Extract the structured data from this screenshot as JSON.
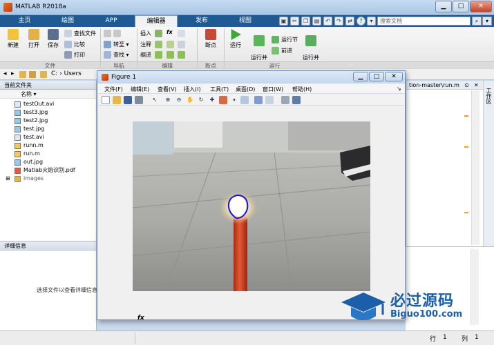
{
  "window": {
    "title": "MATLAB R2018a"
  },
  "tabs": [
    {
      "label": "主页"
    },
    {
      "label": "绘图"
    },
    {
      "label": "APP"
    },
    {
      "label": "编辑器"
    },
    {
      "label": "发布"
    },
    {
      "label": "视图"
    }
  ],
  "search": {
    "placeholder": "搜索文档"
  },
  "ribbon": {
    "file_group": {
      "label": "文件",
      "new": "新建",
      "open": "打开",
      "save": "保存",
      "find_files": "查找文件",
      "compare": "比较",
      "print": "打印"
    },
    "nav_group": {
      "label": "导航",
      "goto": "转至",
      "find": "查找"
    },
    "edit_group": {
      "label": "编辑",
      "insert": "插入",
      "comment": "注释",
      "indent": "缩进",
      "fx": "fx"
    },
    "breakpoint_group": {
      "label": "断点",
      "breakpoints": "断点"
    },
    "run_group": {
      "label": "运行",
      "run": "运行",
      "run_advance": "运行并\n前进",
      "run_section": "运行节",
      "advance": "前进",
      "run_time": "运行并\n计时"
    }
  },
  "address": {
    "path": "C: › Users"
  },
  "folder_panel": {
    "header": "当前文件夹",
    "col_name": "名称",
    "files": [
      {
        "name": "testOut.avi"
      },
      {
        "name": "test3.jpg"
      },
      {
        "name": "test2.jpg"
      },
      {
        "name": "test.jpg"
      },
      {
        "name": "test.avi"
      },
      {
        "name": "runn.m"
      },
      {
        "name": "run.m"
      },
      {
        "name": "out.jpg"
      },
      {
        "name": "Matlab火焰识别.pdf"
      },
      {
        "name": "images"
      }
    ]
  },
  "details_panel": {
    "header": "详细信息",
    "hint": "选择文件以查看详细信息"
  },
  "editor": {
    "tab_label": "tion-master\\run.m",
    "side_label": "工作区"
  },
  "cmd": {
    "prompt": "fx"
  },
  "statusbar": {
    "row_label": "行",
    "row": "1",
    "col_label": "列",
    "col": "1"
  },
  "figure": {
    "title": "Figure 1",
    "menu": [
      {
        "label": "文件(F)"
      },
      {
        "label": "编辑(E)"
      },
      {
        "label": "查看(V)"
      },
      {
        "label": "插入(I)"
      },
      {
        "label": "工具(T)"
      },
      {
        "label": "桌面(D)"
      },
      {
        "label": "窗口(W)"
      },
      {
        "label": "帮助(H)"
      }
    ]
  },
  "watermark": {
    "text": "必过源码",
    "url": "Biguo100.com"
  },
  "colors": {
    "tab_bar": "#1f5a93",
    "flame_contour": "#1a14e0",
    "candle": "#d04422"
  }
}
